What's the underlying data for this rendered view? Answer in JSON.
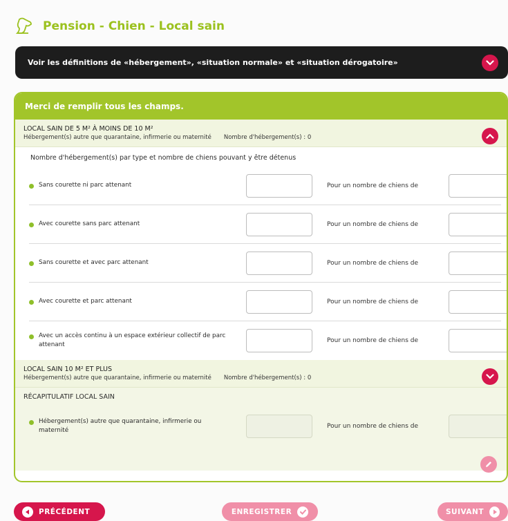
{
  "header": {
    "title": "Pension - Chien - Local sain"
  },
  "definitions": {
    "text": "Voir les définitions de «hébergement», «situation normale» et «situation dérogatoire»"
  },
  "panel": {
    "notice": "Merci de remplir tous les champs."
  },
  "section1": {
    "title": "LOCAL SAIN DE 5 M² À MOINS DE 10 M²",
    "subtitle": "Hébergement(s) autre que quarantaine, infirmerie ou maternité",
    "count": "Nombre d'hébergement(s) : 0",
    "intro": "Nombre d'hébergement(s) par type et nombre de chiens pouvant y être détenus",
    "rows": [
      {
        "label": "Sans courette ni parc attenant",
        "pour": "Pour un nombre de chiens de"
      },
      {
        "label": "Avec courette sans parc attenant",
        "pour": "Pour un nombre de chiens de"
      },
      {
        "label": "Sans courette et avec parc attenant",
        "pour": "Pour un nombre de chiens de"
      },
      {
        "label": "Avec courette et parc attenant",
        "pour": "Pour un nombre de chiens de"
      },
      {
        "label": "Avec un accès continu à un espace extérieur collectif de parc attenant",
        "pour": "Pour un nombre de chiens de"
      }
    ]
  },
  "section2": {
    "title": "LOCAL SAIN 10 M² ET PLUS",
    "subtitle": "Hébergement(s) autre que quarantaine, infirmerie ou maternité",
    "count": "Nombre d'hébergement(s) : 0"
  },
  "recap": {
    "title": "RÉCAPITULATIF LOCAL SAIN",
    "row": {
      "label": "Hébergement(s) autre que quarantaine, infirmerie ou maternité",
      "pour": "Pour un nombre de chiens de"
    }
  },
  "nav": {
    "prev": "PRÉCÉDENT",
    "save": "ENREGISTRER",
    "next": "SUIVANT"
  },
  "colors": {
    "brand_green": "#a2c52a",
    "accent_red": "#d6164c",
    "accent_pink": "#f08fa8",
    "dark": "#1d1d1d"
  }
}
